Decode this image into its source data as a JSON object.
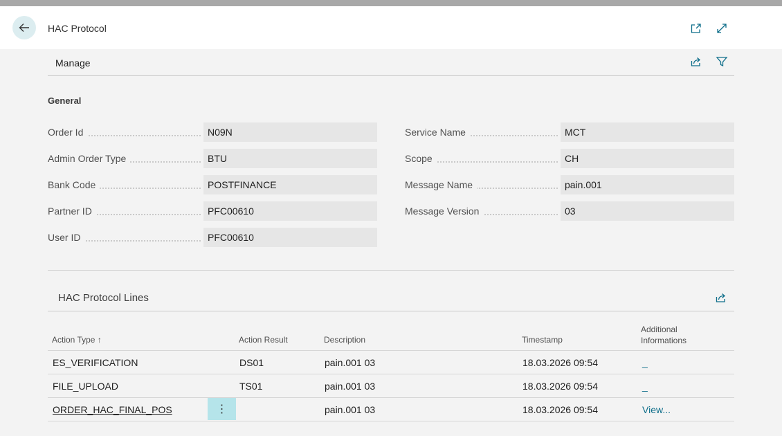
{
  "header": {
    "title": "HAC Protocol"
  },
  "actionbar": {
    "manage_label": "Manage"
  },
  "general": {
    "title": "General",
    "left_fields": [
      {
        "label": "Order Id",
        "value": "N09N"
      },
      {
        "label": "Admin Order Type",
        "value": "BTU"
      },
      {
        "label": "Bank Code",
        "value": "POSTFINANCE"
      },
      {
        "label": "Partner ID",
        "value": "PFC00610"
      },
      {
        "label": "User ID",
        "value": "PFC00610"
      }
    ],
    "right_fields": [
      {
        "label": "Service Name",
        "value": "MCT"
      },
      {
        "label": "Scope",
        "value": "CH"
      },
      {
        "label": "Message Name",
        "value": "pain.001"
      },
      {
        "label": "Message Version",
        "value": "03"
      }
    ]
  },
  "lines": {
    "title": "HAC Protocol Lines",
    "columns": {
      "action_type": "Action Type",
      "sort_indicator": "↑",
      "action_result": "Action Result",
      "description": "Description",
      "timestamp": "Timestamp",
      "additional_1": "Additional",
      "additional_2": "Informations"
    },
    "rows": [
      {
        "action_type": "ES_VERIFICATION",
        "action_result": "DS01",
        "description": "pain.001 03",
        "timestamp": "18.03.2026 09:54",
        "additional": "_"
      },
      {
        "action_type": "FILE_UPLOAD",
        "action_result": "TS01",
        "description": "pain.001 03",
        "timestamp": "18.03.2026 09:54",
        "additional": "_"
      },
      {
        "action_type": "ORDER_HAC_FINAL_POS",
        "action_result": "",
        "description": "pain.001 03",
        "timestamp": "18.03.2026 09:54",
        "additional": "View..."
      }
    ],
    "row_menu_glyph": "⋮"
  },
  "icons": [
    "back-arrow-icon",
    "open-new-window-icon",
    "expand-icon",
    "share-icon",
    "filter-icon"
  ],
  "colors": {
    "accent": "#0e6e8a",
    "selected_row_button": "#b5e4ea",
    "back_button": "#dcedf0"
  }
}
